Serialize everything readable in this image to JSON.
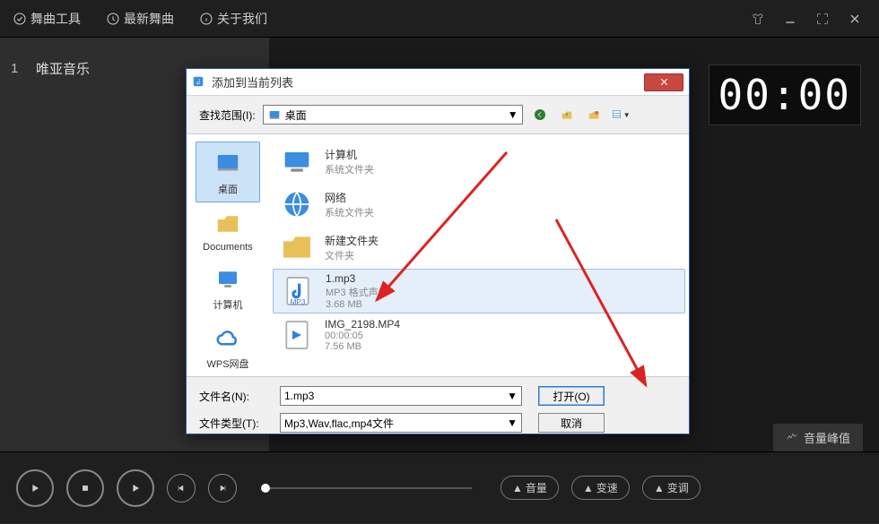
{
  "menubar": {
    "items": [
      {
        "label": "舞曲工具",
        "icon": "wrench-icon"
      },
      {
        "label": "最新舞曲",
        "icon": "clock-icon"
      },
      {
        "label": "关于我们",
        "icon": "info-icon"
      }
    ]
  },
  "playlist": {
    "tracks": [
      {
        "num": "1",
        "title": "唯亚音乐"
      }
    ]
  },
  "display": {
    "timer": "00:00"
  },
  "bottombar": {
    "peak_label": "音量峰值",
    "pills": [
      "音量",
      "变速",
      "变调"
    ]
  },
  "dialog": {
    "title": "添加到当前列表",
    "lookin_label": "查找范围(I):",
    "lookin_value": "桌面",
    "sidebar": [
      {
        "label": "桌面",
        "icon": "desktop",
        "selected": true
      },
      {
        "label": "Documents",
        "icon": "folder",
        "selected": false
      },
      {
        "label": "计算机",
        "icon": "computer",
        "selected": false
      },
      {
        "label": "WPS网盘",
        "icon": "cloud",
        "selected": false
      }
    ],
    "files": [
      {
        "name": "计算机",
        "sub1": "系统文件夹",
        "sub2": "",
        "icon": "computer",
        "selected": false
      },
      {
        "name": "网络",
        "sub1": "系统文件夹",
        "sub2": "",
        "icon": "network",
        "selected": false
      },
      {
        "name": "新建文件夹",
        "sub1": "文件夹",
        "sub2": "",
        "icon": "folder",
        "selected": false
      },
      {
        "name": "1.mp3",
        "sub1": "MP3 格式声音",
        "sub2": "3.68 MB",
        "icon": "mp3",
        "selected": true
      },
      {
        "name": "IMG_2198.MP4",
        "sub1": "00:00:05",
        "sub2": "7.56 MB",
        "icon": "mp4",
        "selected": false
      }
    ],
    "filename_label": "文件名(N):",
    "filename_value": "1.mp3",
    "filetype_label": "文件类型(T):",
    "filetype_value": "Mp3,Wav,flac,mp4文件",
    "open_label": "打开(O)",
    "cancel_label": "取消"
  }
}
